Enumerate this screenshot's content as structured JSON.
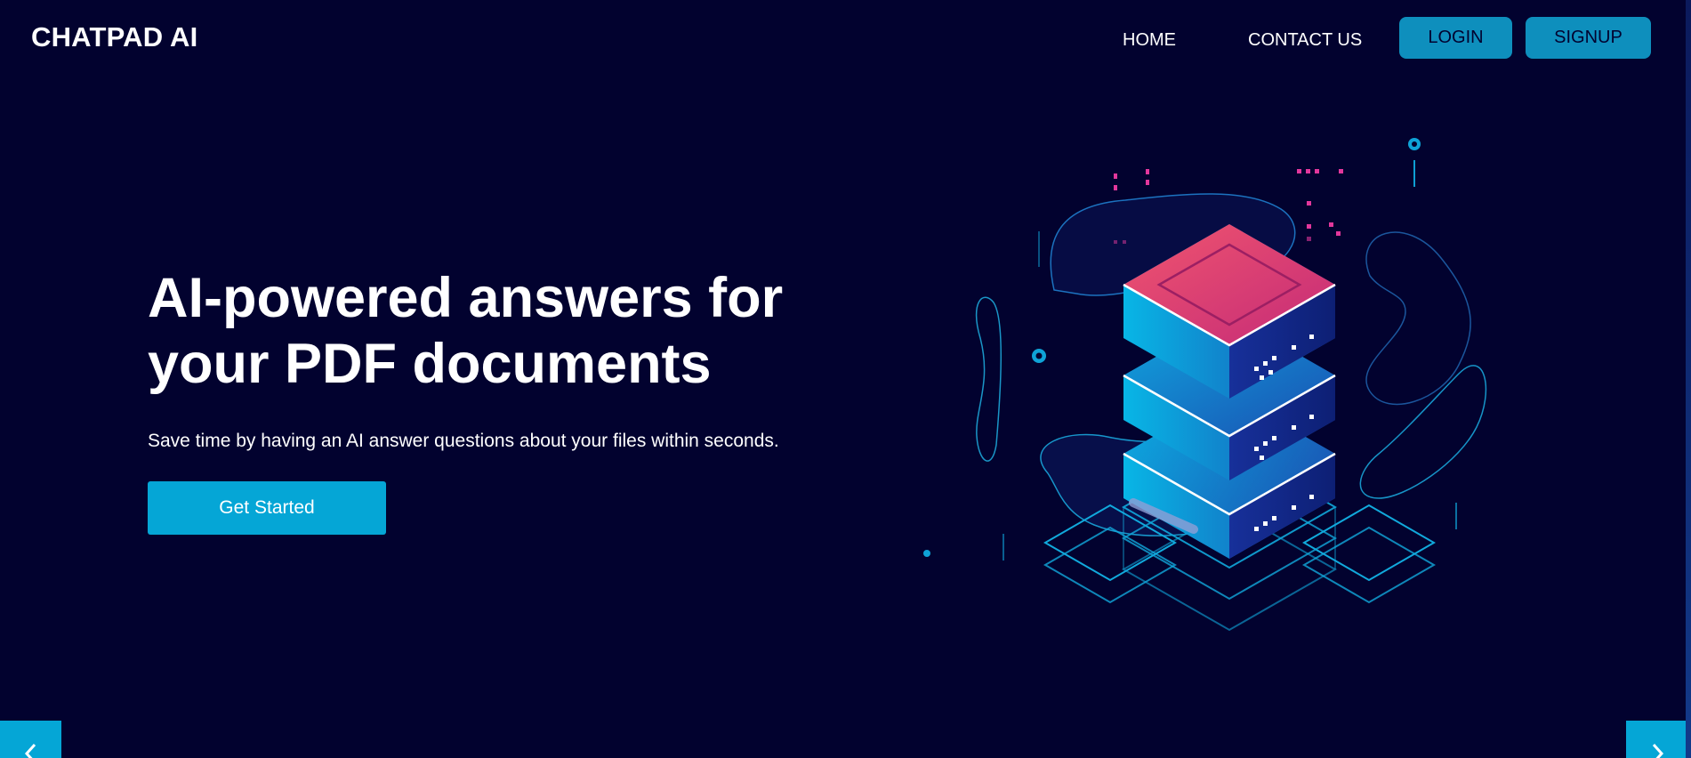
{
  "brand": {
    "name": "CHATPAD AI"
  },
  "nav": {
    "home_label": "HOME",
    "contact_label": "CONTACT US",
    "login_label": "LOGIN",
    "signup_label": "SIGNUP"
  },
  "hero": {
    "title_line1": "AI-powered answers for",
    "title_line2": "your PDF documents",
    "subtitle": "Save time by having an AI answer questions about your files within seconds.",
    "cta_label": "Get Started"
  },
  "carousel": {
    "prev_icon": "chevron-left-icon",
    "next_icon": "chevron-right-icon"
  },
  "colors": {
    "background": "#02022f",
    "accent": "#05a6d6",
    "button_top": "#0e8fbd",
    "server_top": "#e0476f"
  }
}
